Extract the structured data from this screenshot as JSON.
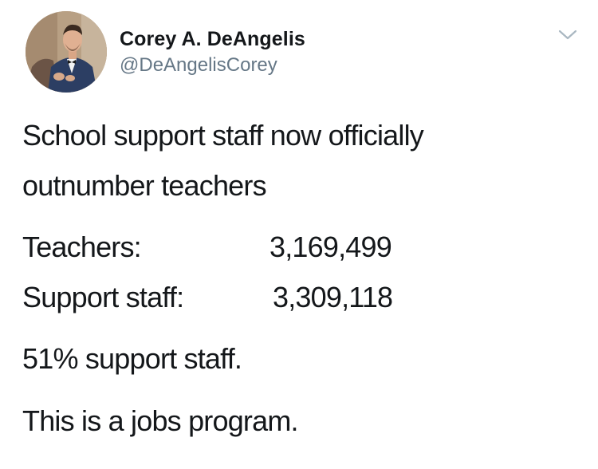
{
  "author": {
    "display_name": "Corey A. DeAngelis",
    "handle": "@DeAngelisCorey"
  },
  "icons": {
    "avatar": "profile-photo",
    "menu": "chevron-down-icon"
  },
  "colors": {
    "text": "#14171a",
    "secondary": "#657786",
    "caret": "#aab8c2"
  },
  "tweet": {
    "line1": "School support staff now officially",
    "line2": "outnumber teachers",
    "stats": [
      {
        "label": "Teachers:",
        "value": "3,169,499"
      },
      {
        "label": "Support staff:",
        "value": "3,309,118"
      }
    ],
    "line3": "51% support staff.",
    "line4": "This is a jobs program."
  }
}
